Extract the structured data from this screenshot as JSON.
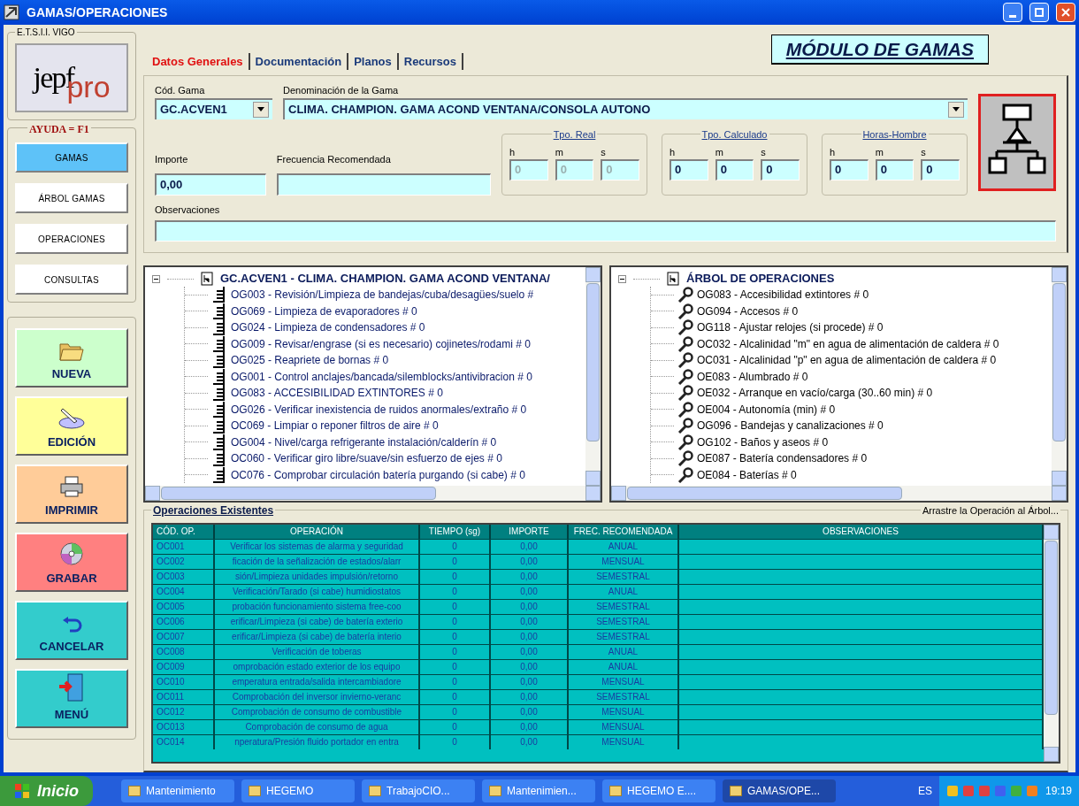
{
  "window": {
    "title": "GAMAS/OPERACIONES"
  },
  "sidebar": {
    "logo_legend": "E.T.S.I.I. VIGO",
    "logo_text": [
      "jepf",
      "pro"
    ],
    "help_legend": "AYUDA = F1",
    "nav": [
      {
        "label": "GAMAS",
        "selected": true
      },
      {
        "label": "ÁRBOL GAMAS",
        "selected": false
      },
      {
        "label": "OPERACIONES",
        "selected": false
      },
      {
        "label": "CONSULTAS",
        "selected": false
      }
    ],
    "actions": [
      {
        "label": "NUEVA",
        "color": "#ccffcc"
      },
      {
        "label": "EDICIÓN",
        "color": "#ffff99"
      },
      {
        "label": "IMPRIMIR",
        "color": "#ffcc99"
      },
      {
        "label": "GRABAR",
        "color": "#ff8080"
      },
      {
        "label": "CANCELAR",
        "color": "#33cccc"
      },
      {
        "label": "MENÚ",
        "color": "#33cccc"
      }
    ]
  },
  "tabs": [
    {
      "label": "Datos Generales",
      "selected": true
    },
    {
      "label": "Documentación",
      "selected": false
    },
    {
      "label": "Planos",
      "selected": false
    },
    {
      "label": "Recursos",
      "selected": false
    }
  ],
  "module_title": "MÓDULO DE GAMAS",
  "form": {
    "cod_gama": {
      "label": "Cód. Gama",
      "value": "GC.ACVEN1"
    },
    "denominacion": {
      "label": "Denominación de la Gama",
      "value": "CLIMA. CHAMPION. GAMA ACOND VENTANA/CONSOLA AUTONO"
    },
    "importe": {
      "label": "Importe",
      "value": "0,00"
    },
    "frecuencia": {
      "label": "Frecuencia Recomendada"
    },
    "observaciones": {
      "label": "Observaciones"
    },
    "time_groups": [
      {
        "title": "Tpo. Real",
        "disabled": true,
        "fields": [
          {
            "label": "h",
            "value": "0"
          },
          {
            "label": "m",
            "value": "0"
          },
          {
            "label": "s",
            "value": "0"
          }
        ]
      },
      {
        "title": "Tpo. Calculado",
        "disabled": false,
        "fields": [
          {
            "label": "h",
            "value": "0"
          },
          {
            "label": "m",
            "value": "0"
          },
          {
            "label": "s",
            "value": "0"
          }
        ]
      },
      {
        "title": "Horas-Hombre",
        "disabled": false,
        "fields": [
          {
            "label": "h",
            "value": "0"
          },
          {
            "label": "m",
            "value": "0"
          },
          {
            "label": "s",
            "value": "0"
          }
        ]
      }
    ]
  },
  "trees": [
    {
      "root": "GC.ACVEN1 - CLIMA. CHAMPION. GAMA ACOND VENTANA/",
      "items": [
        "OG003 - Revisión/Limpieza de bandejas/cuba/desagües/suelo #",
        "OG069 - Limpieza de evaporadores # 0",
        "OG024 - Limpieza de condensadores # 0",
        "OG009 - Revisar/engrase (si es necesario) cojinetes/rodami # 0",
        "OG025 - Reapriete de bornas # 0",
        "OG001 - Control anclajes/bancada/silemblocks/antivibracion # 0",
        "OG083 - ACCESIBILIDAD EXTINTORES # 0",
        "OG026 - Verificar inexistencia de ruidos anormales/extraño # 0",
        "OC069 - Limpiar o reponer filtros de aire # 0",
        "OG004 - Nivel/carga refrigerante instalación/calderín # 0",
        "OC060 - Verificar giro libre/suave/sin esfuerzo de ejes # 0",
        "OC076 - Comprobar circulación batería purgando (si cabe) # 0"
      ]
    },
    {
      "root": "ÁRBOL DE OPERACIONES",
      "items": [
        "OG083 - Accesibilidad extintores # 0",
        "OG094 - Accesos # 0",
        "OG118 - Ajustar relojes (si procede) # 0",
        "OC032 - Alcalinidad \"m\" en agua de alimentación de caldera # 0",
        "OC031 - Alcalinidad \"p\" en agua de alimentación de caldera # 0",
        "OE083 - Alumbrado # 0",
        "OE032 - Arranque en vacío/carga (30..60 min) # 0",
        "OE004 - Autonomía (min) # 0",
        "OG096 - Bandejas y canalizaciones # 0",
        "OG102 - Baños y aseos # 0",
        "OE087 - Batería condensadores # 0",
        "OE084 - Baterías # 0"
      ]
    }
  ],
  "table": {
    "title": "Operaciones Existentes",
    "hint": "Arrastre la Operación al Árbol...",
    "columns": [
      "CÓD. OP.",
      "OPERACIÓN",
      "TIEMPO (sg)",
      "IMPORTE",
      "FREC. RECOMENDADA",
      "OBSERVACIONES"
    ],
    "rows": [
      [
        "OC001",
        "Verificar los sistemas de alarma y seguridad",
        "0",
        "0,00",
        "ANUAL"
      ],
      [
        "OC002",
        "ficación de la señalización de estados/alarr",
        "0",
        "0,00",
        "MENSUAL"
      ],
      [
        "OC003",
        "sión/Limpieza unidades impulsión/retorno",
        "0",
        "0,00",
        "SEMESTRAL"
      ],
      [
        "OC004",
        "Verificación/Tarado (si cabe) humidiostatos",
        "0",
        "0,00",
        "ANUAL"
      ],
      [
        "OC005",
        "probación funcionamiento sistema free-coo",
        "0",
        "0,00",
        "SEMESTRAL"
      ],
      [
        "OC006",
        "erificar/Limpieza (si cabe) de batería exterio",
        "0",
        "0,00",
        "SEMESTRAL"
      ],
      [
        "OC007",
        "erificar/Limpieza (si cabe) de batería interio",
        "0",
        "0,00",
        "SEMESTRAL"
      ],
      [
        "OC008",
        "Verificación de toberas",
        "0",
        "0,00",
        "ANUAL"
      ],
      [
        "OC009",
        "omprobación estado exterior de los equipo",
        "0",
        "0,00",
        "ANUAL"
      ],
      [
        "OC010",
        "emperatura entrada/salida intercambiadore",
        "0",
        "0,00",
        "MENSUAL"
      ],
      [
        "OC011",
        "Comprobación del inversor invierno-veranc",
        "0",
        "0,00",
        "SEMESTRAL"
      ],
      [
        "OC012",
        "Comprobación de consumo de combustible",
        "0",
        "0,00",
        "MENSUAL"
      ],
      [
        "OC013",
        "Comprobación de consumo de agua",
        "0",
        "0,00",
        "MENSUAL"
      ],
      [
        "OC014",
        "nperatura/Presión fluido portador en entra",
        "0",
        "0,00",
        "MENSUAL"
      ]
    ]
  },
  "taskbar": {
    "start": "Inicio",
    "tasks": [
      {
        "label": "Mantenimiento",
        "selected": false
      },
      {
        "label": "HEGEMO",
        "selected": false
      },
      {
        "label": "TrabajoCIO...",
        "selected": false
      },
      {
        "label": "Mantenimien...",
        "selected": false
      },
      {
        "label": "HEGEMO E....",
        "selected": false
      },
      {
        "label": "GAMAS/OPE...",
        "selected": true
      }
    ],
    "language": "ES",
    "clock": "19:19"
  }
}
